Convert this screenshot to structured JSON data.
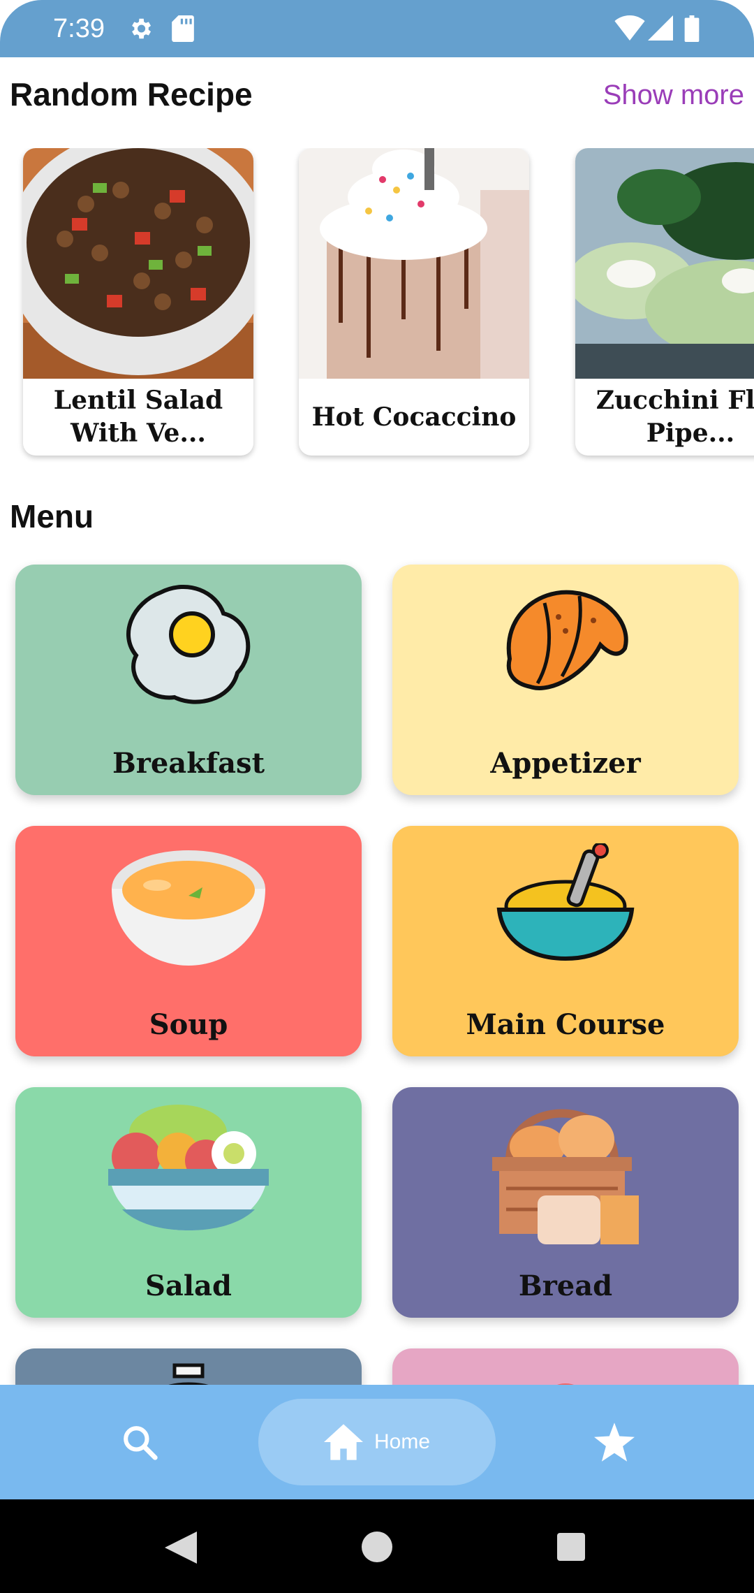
{
  "status": {
    "time": "7:39"
  },
  "random_section": {
    "title": "Random Recipe",
    "show_more": "Show more"
  },
  "recipes": [
    {
      "title": "Lentil Salad With Ve..."
    },
    {
      "title": "Hot Cocaccino"
    },
    {
      "title": "Zucchini Flut Pipe..."
    }
  ],
  "menu_section": {
    "title": "Menu"
  },
  "menu": [
    {
      "label": "Breakfast",
      "color": "#97CDB1"
    },
    {
      "label": "Appetizer",
      "color": "#FFEBA8"
    },
    {
      "label": "Soup",
      "color": "#FF6F6A"
    },
    {
      "label": "Main Course",
      "color": "#FFC75A"
    },
    {
      "label": "Salad",
      "color": "#8AD9A9"
    },
    {
      "label": "Bread",
      "color": "#6F6FA2"
    },
    {
      "label": "",
      "color": "#6C87A1"
    },
    {
      "label": "",
      "color": "#E6A6C4"
    }
  ],
  "nav": {
    "search_icon": "search-icon",
    "home_label": "Home",
    "favorites_icon": "star-icon"
  },
  "colors": {
    "status_bar": "#65A0CE",
    "accent": "#9A3DB8",
    "bottom_nav": "#79B9EF",
    "nav_pill": "#9ACBF4"
  }
}
